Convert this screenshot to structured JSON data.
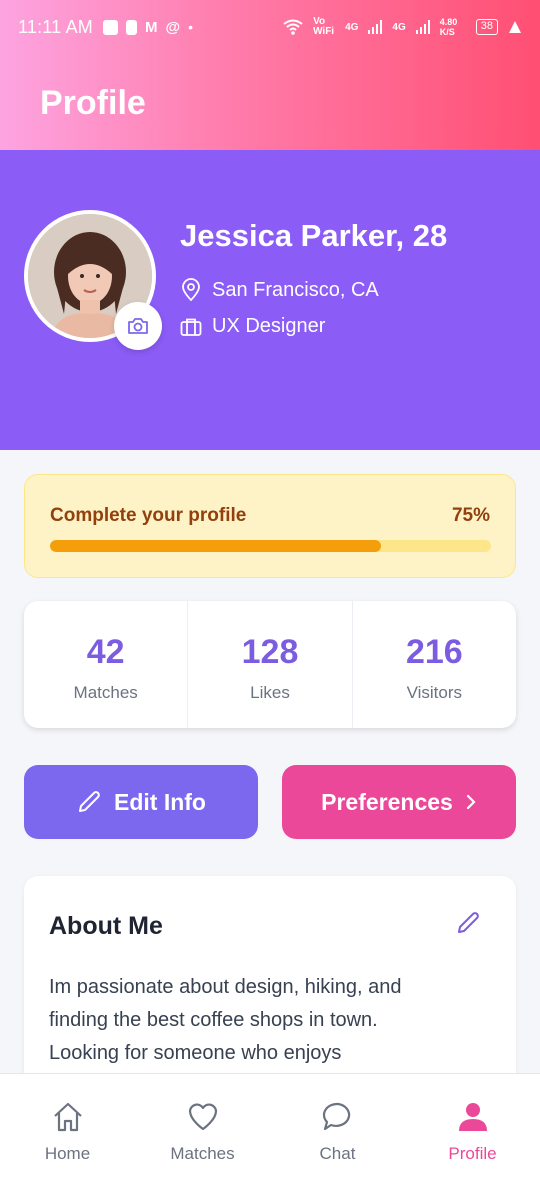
{
  "status_bar": {
    "time": "11:11 AM",
    "network_labels": [
      "Vo WiFi",
      "4G",
      "4G"
    ],
    "speed": "4.80 K/S",
    "battery": "38"
  },
  "header": {
    "title": "Profile"
  },
  "profile": {
    "name": "Jessica Parker, 28",
    "location": "San Francisco, CA",
    "job": "UX Designer"
  },
  "completion": {
    "label": "Complete your profile",
    "percent_text": "75%",
    "progress": 0.75
  },
  "stats": [
    {
      "value": "42",
      "label": "Matches"
    },
    {
      "value": "128",
      "label": "Likes"
    },
    {
      "value": "216",
      "label": "Visitors"
    }
  ],
  "actions": {
    "edit_label": "Edit Info",
    "preferences_label": "Preferences"
  },
  "about": {
    "title": "About Me",
    "text": "Im passionate about design, hiking, and finding the best coffee shops in town. Looking for someone who enjoys"
  },
  "nav": [
    {
      "label": "Home",
      "icon": "home-icon",
      "active": false
    },
    {
      "label": "Matches",
      "icon": "heart-icon",
      "active": false
    },
    {
      "label": "Chat",
      "icon": "chat-icon",
      "active": false
    },
    {
      "label": "Profile",
      "icon": "user-icon",
      "active": true
    }
  ],
  "colors": {
    "hero": "#8b5cf6",
    "accent_purple": "#7b68ee",
    "accent_pink": "#ec4899",
    "progress_fill": "#f59e0b"
  }
}
